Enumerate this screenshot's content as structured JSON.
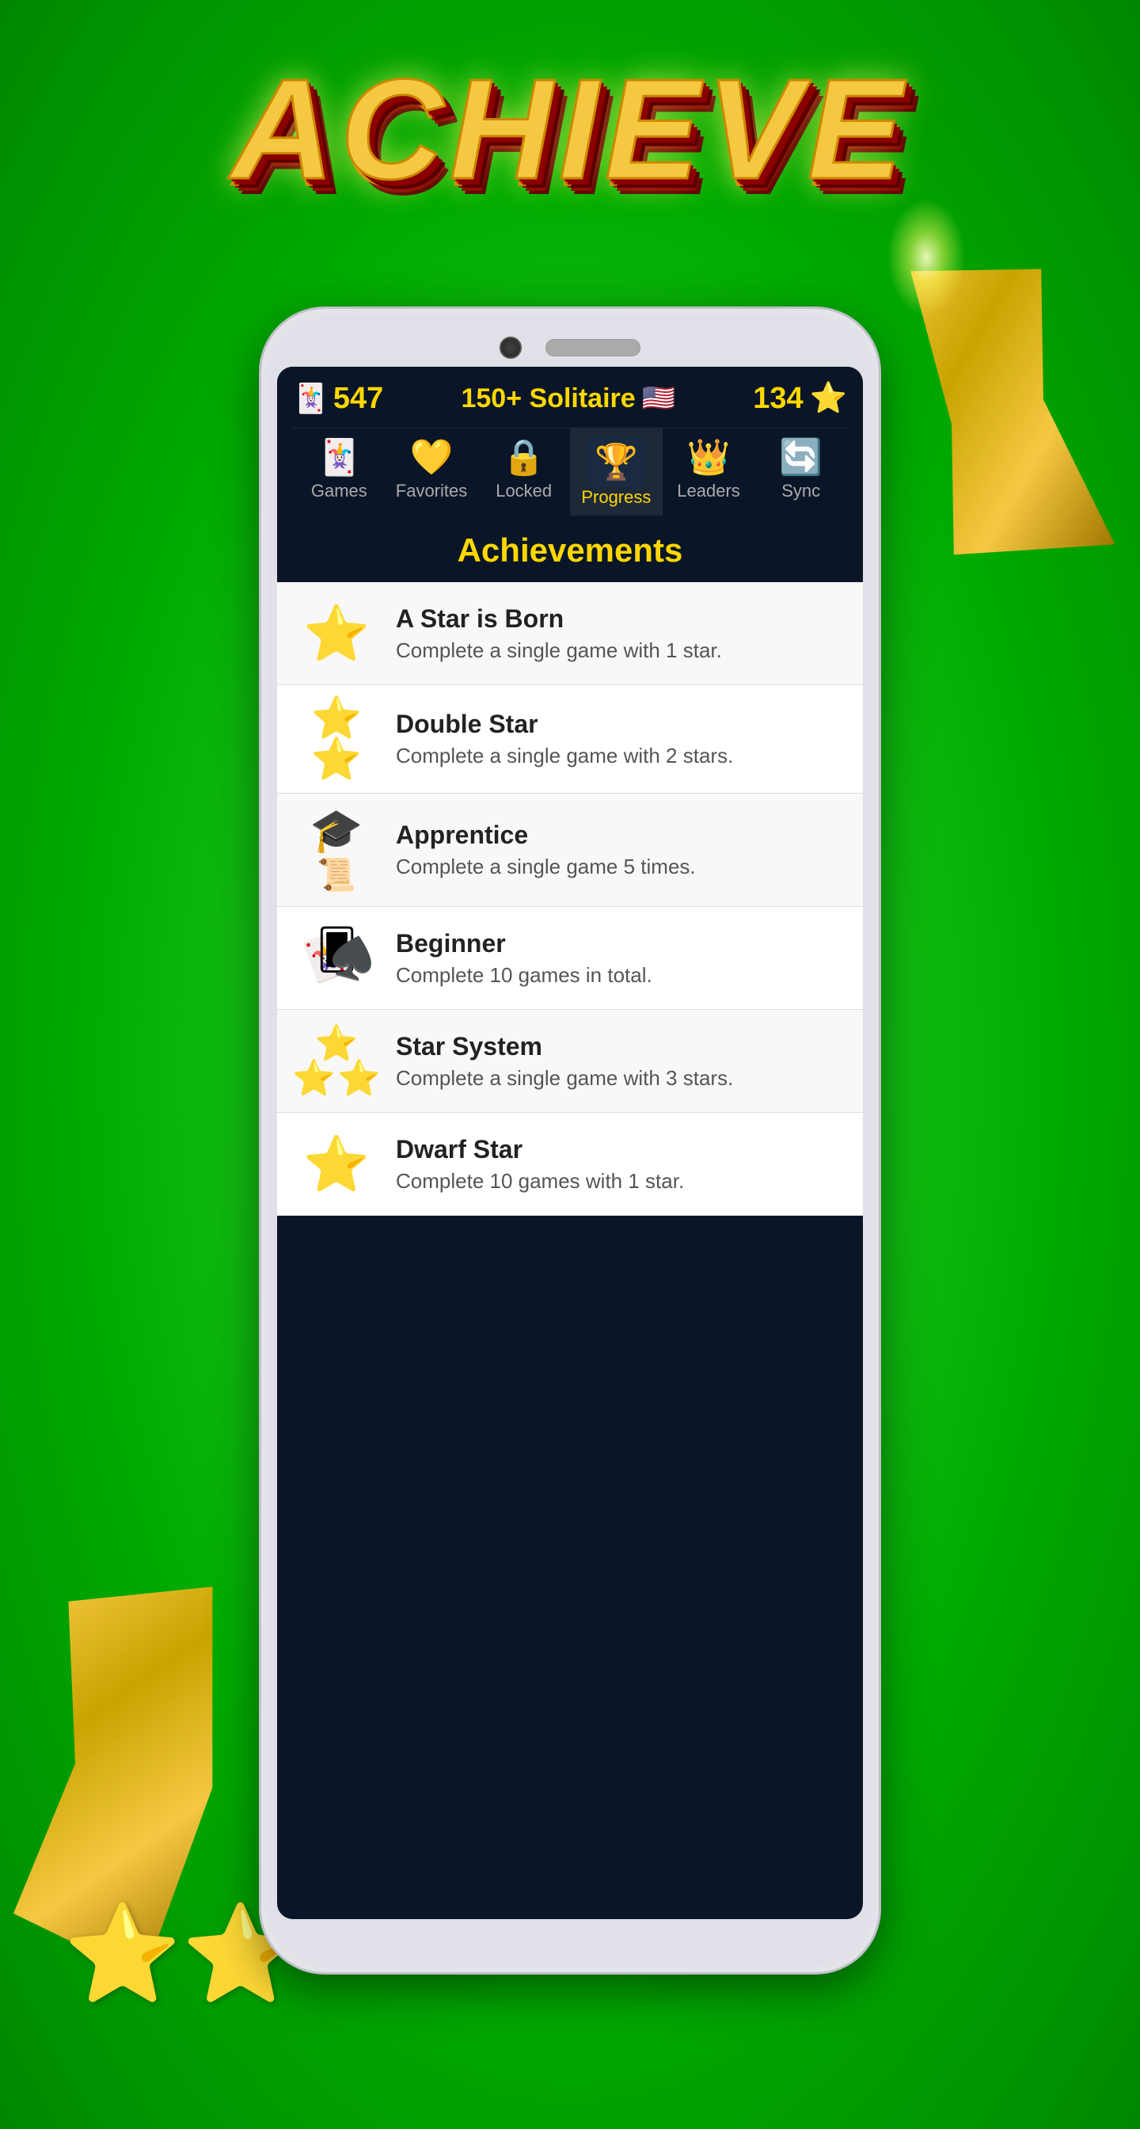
{
  "title": "ACHIEVE",
  "header": {
    "score_left": "547",
    "app_name": "150+ Solitaire",
    "flag": "🇺🇸",
    "score_right": "134",
    "star_icon": "⭐"
  },
  "nav": {
    "tabs": [
      {
        "id": "games",
        "label": "Games",
        "icon": "🃏",
        "active": false
      },
      {
        "id": "favorites",
        "label": "Favorites",
        "icon": "💛",
        "active": false
      },
      {
        "id": "locked",
        "label": "Locked",
        "icon": "🔒",
        "active": false
      },
      {
        "id": "progress",
        "label": "Progress",
        "icon": "🏆",
        "active": true
      },
      {
        "id": "leaders",
        "label": "Leaders",
        "icon": "👑",
        "active": false
      },
      {
        "id": "sync",
        "label": "Sync",
        "icon": "🔄",
        "active": false
      }
    ]
  },
  "achievements_title": "Achievements",
  "achievements": [
    {
      "id": "star-born",
      "name": "A Star is Born",
      "description": "Complete a single game with 1 star.",
      "icon": "⭐",
      "icon_size": "large",
      "icon_display": "⭐"
    },
    {
      "id": "double-star",
      "name": "Double Star",
      "description": "Complete a single game with 2 stars.",
      "icon": "⭐⭐",
      "icon_display": "two-stars"
    },
    {
      "id": "apprentice",
      "name": "Apprentice",
      "description": "Complete a single game 5 times.",
      "icon": "🎓",
      "icon_display": "grad"
    },
    {
      "id": "beginner",
      "name": "Beginner",
      "description": "Complete 10 games in total.",
      "icon": "🃏",
      "icon_display": "cards"
    },
    {
      "id": "star-system",
      "name": "Star System",
      "description": "Complete a single game with 3 stars.",
      "icon": "⭐⭐⭐",
      "icon_display": "three-stars"
    },
    {
      "id": "dwarf-star",
      "name": "Dwarf Star",
      "description": "Complete 10 games with 1 star.",
      "icon": "⭐",
      "icon_display": "star-small"
    }
  ]
}
